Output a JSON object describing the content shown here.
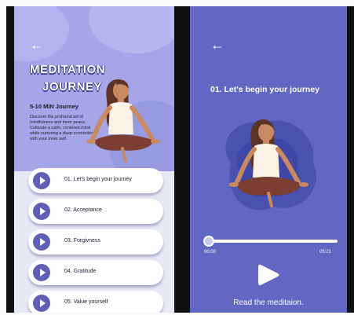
{
  "left_screen": {
    "title_line1": "MEDITATION",
    "title_line2": "JOURNEY",
    "subtitle": "5-10 MIN Journey",
    "description": "Discover the profound art of mindfulness and inner peace. Cultivate a calm, centered mind while nurturing a deep connection with your inner self.",
    "back_icon": "←",
    "items": [
      {
        "label": "01. Let's begin your journey"
      },
      {
        "label": "02. Acceptance"
      },
      {
        "label": "03. Forgivness"
      },
      {
        "label": "04. Gratitude"
      },
      {
        "label": "05. Value yourself"
      }
    ]
  },
  "right_screen": {
    "back_icon": "←",
    "track_title": "01. Let's begin your journey",
    "time_elapsed": "00:00",
    "time_total": "05:21",
    "progress": 0,
    "read_label": "Read the meditaion."
  },
  "colors": {
    "left_bg": "#e8e9f6",
    "hero_bg": "#a4a6e8",
    "right_bg": "#6167c2",
    "accent": "#5f5fb8",
    "title_outline": "#3d3c8f"
  }
}
